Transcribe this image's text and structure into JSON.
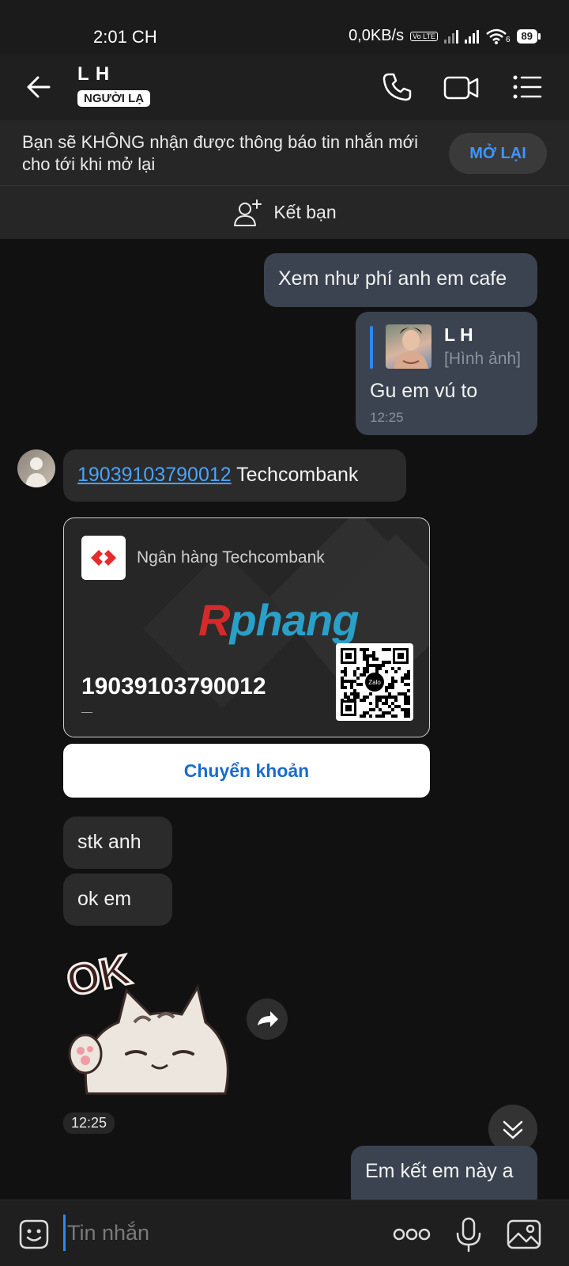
{
  "status": {
    "time": "2:01 CH",
    "net_speed": "0,0KB/s",
    "lte": "Vo LTE",
    "battery": "89",
    "wifi_num": "6"
  },
  "header": {
    "title": "L H",
    "badge": "NGƯỜI LẠ"
  },
  "notice": {
    "text": "Bạn sẽ KHÔNG nhận được thông báo tin nhắn mới cho tới khi mở lại",
    "button": "MỞ LẠI"
  },
  "add_friend": {
    "label": "Kết bạn"
  },
  "messages": {
    "m1": {
      "text": "Xem như phí anh em cafe"
    },
    "m2": {
      "quote_name": "L H",
      "quote_type": "[Hình ảnh]",
      "text": "Gu em vú to",
      "time": "12:25"
    },
    "m3": {
      "account": "19039103790012",
      "bank": "Techcombank"
    },
    "card": {
      "bank_name": "Ngân hàng Techcombank",
      "account": "19039103790012",
      "sub": "—",
      "watermark_a": "R",
      "watermark_b": "phang",
      "qr_label": "Zalo"
    },
    "transfer_button": "Chuyển khoản",
    "m4": {
      "text": "stk anh"
    },
    "m5": {
      "text": "ok em"
    },
    "sticker": {
      "text": "OK"
    },
    "sticker_time": "12:25",
    "m6": {
      "text": "Em kết em này a"
    }
  },
  "composer": {
    "placeholder": "Tin nhắn"
  },
  "colors": {
    "accent": "#2f86ff",
    "bubble_out": "#3a434f",
    "bubble_in": "#2b2b2b",
    "link": "#4aa3ff"
  }
}
